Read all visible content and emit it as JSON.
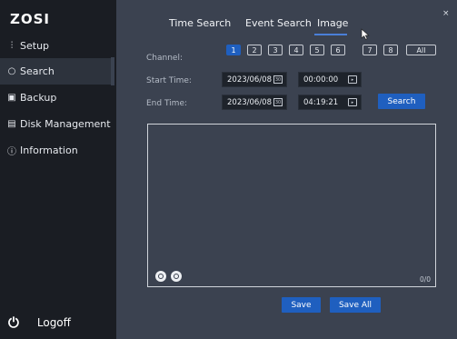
{
  "app": {
    "logo": "ZOSI",
    "close_glyph": "×"
  },
  "sidebar": {
    "items": [
      {
        "label": "Setup",
        "icon": "sliders-icon",
        "glyph": "⫶"
      },
      {
        "label": "Search",
        "icon": "search-icon",
        "glyph": "○"
      },
      {
        "label": "Backup",
        "icon": "backup-icon",
        "glyph": "▣"
      },
      {
        "label": "Disk Management",
        "icon": "disk-icon",
        "glyph": "▤"
      },
      {
        "label": "Information",
        "icon": "info-icon",
        "glyph": "ⓘ"
      }
    ],
    "active_index": 1,
    "logoff_label": "Logoff",
    "logoff_glyph": "⏻"
  },
  "tabs": [
    {
      "label": "Time Search"
    },
    {
      "label": "Event Search"
    },
    {
      "label": "Image"
    }
  ],
  "active_tab": 2,
  "form": {
    "channel_label": "Channel:",
    "channels": [
      "1",
      "2",
      "3",
      "4",
      "5",
      "6",
      "7",
      "8",
      "All"
    ],
    "selected_channel": "1",
    "start_label": "Start Time:",
    "start_date": "2023/06/08",
    "start_time": "00:00:00",
    "end_label": "End Time:",
    "end_date": "2023/06/08",
    "end_time": "04:19:21",
    "search_button": "Search",
    "calendar_glyph": "30",
    "time_glyph": "▸"
  },
  "preview": {
    "count": "0/0"
  },
  "actions": {
    "save": "Save",
    "save_all": "Save All"
  },
  "colors": {
    "accent": "#1f5fbf",
    "sidebar_bg": "#1a1d23",
    "panel_bg": "#3b4250"
  }
}
